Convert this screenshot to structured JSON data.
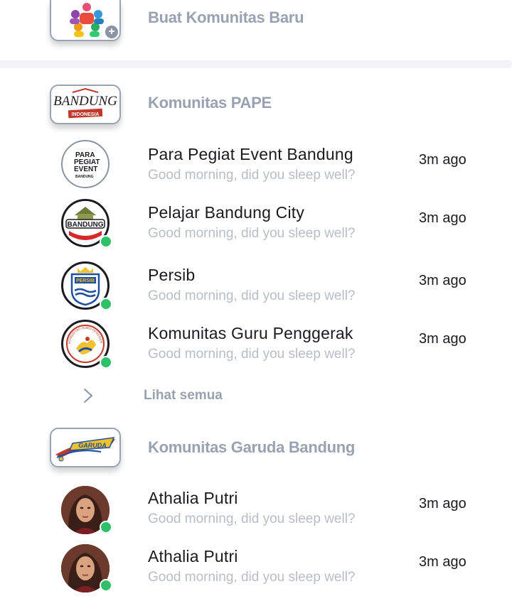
{
  "create_community": {
    "label": "Buat Komunitas Baru",
    "icon": "community-people-icon",
    "badge_icon": "plus-icon"
  },
  "groups": [
    {
      "title": "Komunitas PAPE",
      "logo_icon": "bandung-indonesia-logo",
      "logo_text_top": "BANDUNG",
      "logo_text_bottom": "INDONESIA",
      "chats": [
        {
          "name": "Para Pegiat Event Bandung",
          "message": "Good morning, did you sleep well?",
          "time": "3m ago",
          "online": false,
          "avatar_lines": [
            "PARA",
            "PEGIAT",
            "EVENT",
            "BANDUNG"
          ]
        },
        {
          "name": "Pelajar Bandung City",
          "message": "Good morning, did you sleep well?",
          "time": "3m ago",
          "online": true,
          "avatar_text": "BANDUNG"
        },
        {
          "name": "Persib",
          "message": "Good morning, did you sleep well?",
          "time": "3m ago",
          "online": true,
          "avatar_text": "PERSIB"
        },
        {
          "name": "Komunitas Guru Penggerak",
          "message": "Good morning, did you sleep well?",
          "time": "3m ago",
          "online": true,
          "avatar_text": "KOMUNITAS GURU PENGGERAK"
        }
      ]
    },
    {
      "title": "Komunitas Garuda Bandung",
      "logo_icon": "garuda-logo",
      "logo_text": "GARUDA",
      "chats": [
        {
          "name": "Athalia Putri",
          "message": "Good morning, did you sleep well?",
          "time": "3m ago",
          "online": true
        },
        {
          "name": "Athalia Putri",
          "message": "Good morning, did you sleep well?",
          "time": "3m ago",
          "online": true
        }
      ]
    }
  ],
  "see_all": {
    "label": "Lihat semua",
    "icon": "chevron-right-icon"
  },
  "colors": {
    "online": "#2fc06a",
    "muted_title": "#9aa1b0",
    "message": "#b8bdc6",
    "text": "#1b1b1f"
  }
}
